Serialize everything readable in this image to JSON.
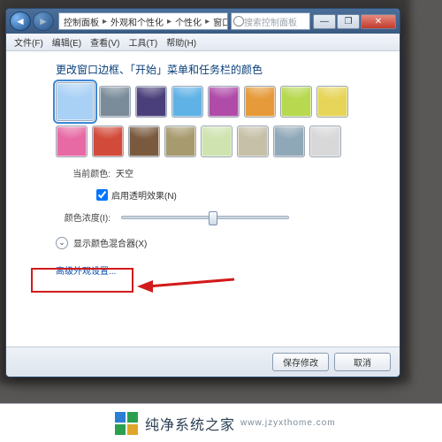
{
  "breadcrumb": {
    "seg1": "控制面板",
    "seg2": "外观和个性化",
    "seg3": "个性化",
    "seg4": "窗口颜色和外观"
  },
  "search": {
    "placeholder": "搜索控制面板"
  },
  "winbtn": {
    "min": "—",
    "max": "❐",
    "close": "✕"
  },
  "menu": {
    "file": "文件(F)",
    "edit": "编辑(E)",
    "view": "查看(V)",
    "tools": "工具(T)",
    "help": "帮助(H)"
  },
  "heading": "更改窗口边框、「开始」菜单和任务栏的颜色",
  "swatches_row1": [
    "#a9d0f5",
    "#7a8b99",
    "#4a3f7a",
    "#5fb2e6",
    "#b04ba8",
    "#e69a3a",
    "#b7d84f",
    "#e7d55a"
  ],
  "swatches_row2": [
    "#e76aa4",
    "#d24a3a",
    "#7a5a3f",
    "#a79a6f",
    "#cfe3b0",
    "#c6c0a8",
    "#8fa8b8",
    "#d8d8d8"
  ],
  "current_color": {
    "label": "当前颜色:",
    "value": "天空"
  },
  "transparency": {
    "label": "启用透明效果(N)"
  },
  "intensity": {
    "label": "颜色浓度(I):"
  },
  "mixer": {
    "label": "显示颜色混合器(X)"
  },
  "advanced_link": "高级外观设置...",
  "footer": {
    "save": "保存修改",
    "cancel": "取消"
  },
  "watermark": {
    "text": "纯净系统之家",
    "sub": "www.jzyxthome.com"
  }
}
